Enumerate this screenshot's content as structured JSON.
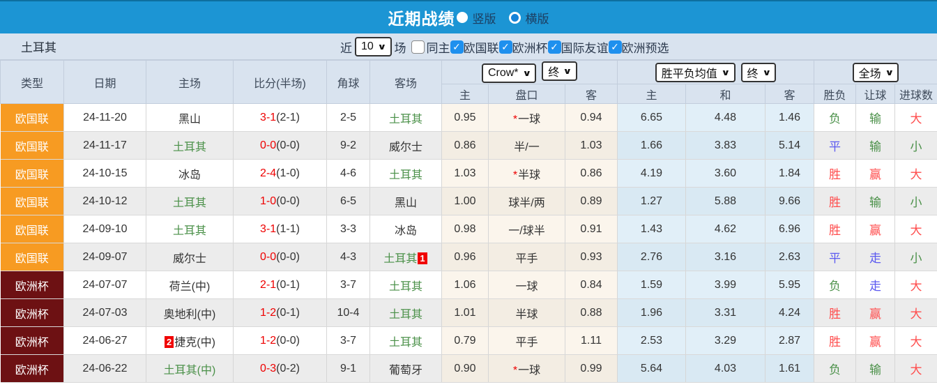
{
  "colors": {
    "bar_blue": "#1c95d4",
    "checkbox_blue": "#1e90ee",
    "orange": "#f79b22",
    "maroon": "#6d1113",
    "green": "#4a9048",
    "red": "#ff4d4d",
    "blue": "#5b59f0",
    "score_red": "#ee0000"
  },
  "title_bar": {
    "title": "近期战绩",
    "radio_vertical": "竖版",
    "radio_horizontal": "横版"
  },
  "filter_bar": {
    "team": "土耳其",
    "recent_label": "近",
    "recent_value": "10",
    "matches_label": "场",
    "same_home_label": "同主",
    "same_home_checked": false,
    "leagues": [
      {
        "label": "欧国联",
        "checked": true
      },
      {
        "label": "欧洲杯",
        "checked": true
      },
      {
        "label": "国际友谊",
        "checked": true
      },
      {
        "label": "欧洲预选",
        "checked": true
      }
    ]
  },
  "table": {
    "dropdowns": {
      "odds_source": "Crow*",
      "odds_time": "终",
      "avg_label": "胜平负均值",
      "avg_time": "终",
      "scope": "全场"
    },
    "headers": {
      "type": "类型",
      "date": "日期",
      "home": "主场",
      "score": "比分(半场)",
      "corners": "角球",
      "away": "客场",
      "odds_home": "主",
      "line": "盘口",
      "odds_away": "客",
      "avg_home": "主",
      "avg_draw": "和",
      "avg_away": "客",
      "result": "胜负",
      "handicap": "让球",
      "goals": "进球数"
    },
    "rows": [
      {
        "league": "欧国联",
        "league_type": "orange",
        "date": "24-11-20",
        "home": "黑山",
        "home_green": false,
        "home_badge": "",
        "score_ft": "3-1",
        "score_ht": "(2-1)",
        "corners": "2-5",
        "away": "土耳其",
        "away_green": true,
        "away_badge": "",
        "odds_home": "0.95",
        "line_star": true,
        "line": "一球",
        "odds_away": "0.94",
        "avg_home": "6.65",
        "avg_draw": "4.48",
        "avg_away": "1.46",
        "result": "负",
        "result_c": "g",
        "handicap": "输",
        "handicap_c": "g",
        "goals": "大",
        "goals_c": "r"
      },
      {
        "league": "欧国联",
        "league_type": "orange",
        "date": "24-11-17",
        "home": "土耳其",
        "home_green": true,
        "home_badge": "",
        "score_ft": "0-0",
        "score_ht": "(0-0)",
        "corners": "9-2",
        "away": "威尔士",
        "away_green": false,
        "away_badge": "",
        "odds_home": "0.86",
        "line_star": false,
        "line": "半/一",
        "odds_away": "1.03",
        "avg_home": "1.66",
        "avg_draw": "3.83",
        "avg_away": "5.14",
        "result": "平",
        "result_c": "b",
        "handicap": "输",
        "handicap_c": "g",
        "goals": "小",
        "goals_c": "g"
      },
      {
        "league": "欧国联",
        "league_type": "orange",
        "date": "24-10-15",
        "home": "冰岛",
        "home_green": false,
        "home_badge": "",
        "score_ft": "2-4",
        "score_ht": "(1-0)",
        "corners": "4-6",
        "away": "土耳其",
        "away_green": true,
        "away_badge": "",
        "odds_home": "1.03",
        "line_star": true,
        "line": "半球",
        "odds_away": "0.86",
        "avg_home": "4.19",
        "avg_draw": "3.60",
        "avg_away": "1.84",
        "result": "胜",
        "result_c": "r",
        "handicap": "赢",
        "handicap_c": "r",
        "goals": "大",
        "goals_c": "r"
      },
      {
        "league": "欧国联",
        "league_type": "orange",
        "date": "24-10-12",
        "home": "土耳其",
        "home_green": true,
        "home_badge": "",
        "score_ft": "1-0",
        "score_ht": "(0-0)",
        "corners": "6-5",
        "away": "黑山",
        "away_green": false,
        "away_badge": "",
        "odds_home": "1.00",
        "line_star": false,
        "line": "球半/两",
        "odds_away": "0.89",
        "avg_home": "1.27",
        "avg_draw": "5.88",
        "avg_away": "9.66",
        "result": "胜",
        "result_c": "r",
        "handicap": "输",
        "handicap_c": "g",
        "goals": "小",
        "goals_c": "g"
      },
      {
        "league": "欧国联",
        "league_type": "orange",
        "date": "24-09-10",
        "home": "土耳其",
        "home_green": true,
        "home_badge": "",
        "score_ft": "3-1",
        "score_ht": "(1-1)",
        "corners": "3-3",
        "away": "冰岛",
        "away_green": false,
        "away_badge": "",
        "odds_home": "0.98",
        "line_star": false,
        "line": "一/球半",
        "odds_away": "0.91",
        "avg_home": "1.43",
        "avg_draw": "4.62",
        "avg_away": "6.96",
        "result": "胜",
        "result_c": "r",
        "handicap": "赢",
        "handicap_c": "r",
        "goals": "大",
        "goals_c": "r"
      },
      {
        "league": "欧国联",
        "league_type": "orange",
        "date": "24-09-07",
        "home": "威尔士",
        "home_green": false,
        "home_badge": "",
        "score_ft": "0-0",
        "score_ht": "(0-0)",
        "corners": "4-3",
        "away": "土耳其",
        "away_green": true,
        "away_badge": "1",
        "odds_home": "0.96",
        "line_star": false,
        "line": "平手",
        "odds_away": "0.93",
        "avg_home": "2.76",
        "avg_draw": "3.16",
        "avg_away": "2.63",
        "result": "平",
        "result_c": "b",
        "handicap": "走",
        "handicap_c": "b",
        "goals": "小",
        "goals_c": "g"
      },
      {
        "league": "欧洲杯",
        "league_type": "maroon",
        "date": "24-07-07",
        "home": "荷兰(中)",
        "home_green": false,
        "home_badge": "",
        "score_ft": "2-1",
        "score_ht": "(0-1)",
        "corners": "3-7",
        "away": "土耳其",
        "away_green": true,
        "away_badge": "",
        "odds_home": "1.06",
        "line_star": false,
        "line": "一球",
        "odds_away": "0.84",
        "avg_home": "1.59",
        "avg_draw": "3.99",
        "avg_away": "5.95",
        "result": "负",
        "result_c": "g",
        "handicap": "走",
        "handicap_c": "b",
        "goals": "大",
        "goals_c": "r"
      },
      {
        "league": "欧洲杯",
        "league_type": "maroon",
        "date": "24-07-03",
        "home": "奥地利(中)",
        "home_green": false,
        "home_badge": "",
        "score_ft": "1-2",
        "score_ht": "(0-1)",
        "corners": "10-4",
        "away": "土耳其",
        "away_green": true,
        "away_badge": "",
        "odds_home": "1.01",
        "line_star": false,
        "line": "半球",
        "odds_away": "0.88",
        "avg_home": "1.96",
        "avg_draw": "3.31",
        "avg_away": "4.24",
        "result": "胜",
        "result_c": "r",
        "handicap": "赢",
        "handicap_c": "r",
        "goals": "大",
        "goals_c": "r"
      },
      {
        "league": "欧洲杯",
        "league_type": "maroon",
        "date": "24-06-27",
        "home": "捷克(中)",
        "home_green": false,
        "home_badge": "2",
        "score_ft": "1-2",
        "score_ht": "(0-0)",
        "corners": "3-7",
        "away": "土耳其",
        "away_green": true,
        "away_badge": "",
        "odds_home": "0.79",
        "line_star": false,
        "line": "平手",
        "odds_away": "1.11",
        "avg_home": "2.53",
        "avg_draw": "3.29",
        "avg_away": "2.87",
        "result": "胜",
        "result_c": "r",
        "handicap": "赢",
        "handicap_c": "r",
        "goals": "大",
        "goals_c": "r"
      },
      {
        "league": "欧洲杯",
        "league_type": "maroon",
        "date": "24-06-22",
        "home": "土耳其(中)",
        "home_green": true,
        "home_badge": "",
        "score_ft": "0-3",
        "score_ht": "(0-2)",
        "corners": "9-1",
        "away": "葡萄牙",
        "away_green": false,
        "away_badge": "",
        "odds_home": "0.90",
        "line_star": true,
        "line": "一球",
        "odds_away": "0.99",
        "avg_home": "5.64",
        "avg_draw": "4.03",
        "avg_away": "1.61",
        "result": "负",
        "result_c": "g",
        "handicap": "输",
        "handicap_c": "g",
        "goals": "大",
        "goals_c": "r"
      }
    ]
  }
}
